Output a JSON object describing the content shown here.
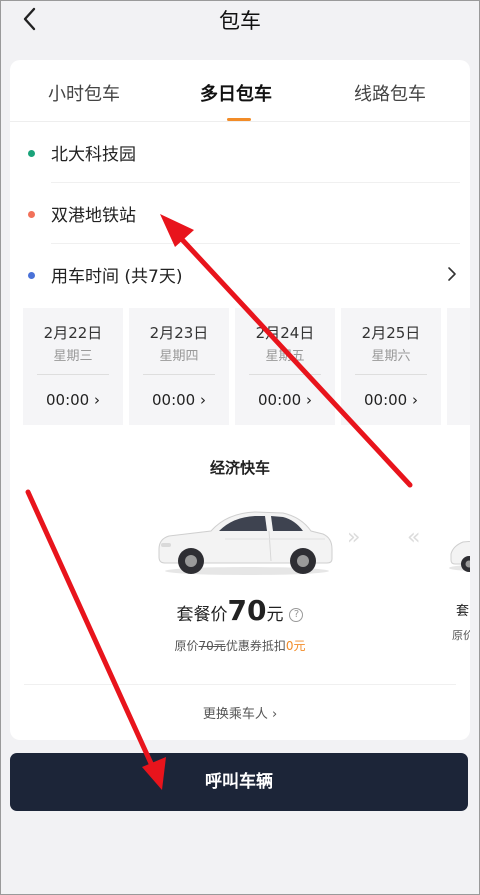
{
  "header": {
    "title": "包车",
    "back_icon": "chevron-left-icon"
  },
  "tabs": [
    {
      "label": "小时包车",
      "active": false
    },
    {
      "label": "多日包车",
      "active": true
    },
    {
      "label": "线路包车",
      "active": false
    }
  ],
  "route": {
    "start": {
      "label": "北大科技园",
      "dot_color": "#1aa37a"
    },
    "end": {
      "label": "双港地铁站",
      "dot_color": "#f2715a"
    },
    "time": {
      "label": "用车时间 (共7天)",
      "dot_color": "#4a72d8"
    }
  },
  "days": [
    {
      "date": "2月22日",
      "weekday": "星期三",
      "time": "00:00 ›"
    },
    {
      "date": "2月23日",
      "weekday": "星期四",
      "time": "00:00 ›"
    },
    {
      "date": "2月24日",
      "weekday": "星期五",
      "time": "00:00 ›"
    },
    {
      "date": "2月25日",
      "weekday": "星期六",
      "time": "00:00 ›"
    }
  ],
  "vehicle": {
    "name": "经济快车",
    "price_prefix": "套餐价",
    "price": "70",
    "price_unit": "元",
    "info_icon": "?",
    "orig_prefix": "原价",
    "orig_price": "70元",
    "coupon_text": "优惠券抵扣",
    "coupon_value": "0元",
    "peek_price": "套",
    "peek_orig": "原价"
  },
  "change_passenger": "更换乘车人 ›",
  "call_button": "呼叫车辆",
  "colors": {
    "accent": "#f28c28",
    "button_bg": "#1c2538",
    "arrow": "#e8141c"
  }
}
